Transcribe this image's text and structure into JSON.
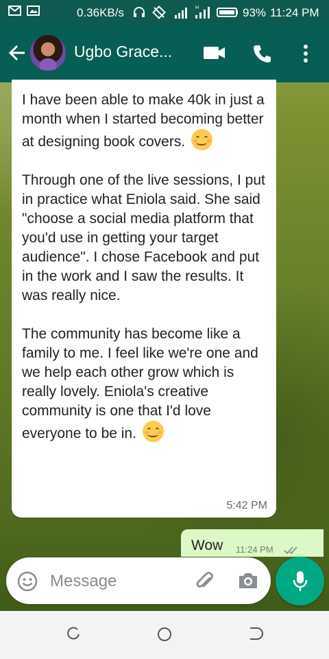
{
  "status_bar": {
    "speed": "0.36KB/s",
    "battery": "93%",
    "time": "11:24 PM"
  },
  "header": {
    "contact_name": "Ugbo Grace..."
  },
  "messages": [
    {
      "direction": "incoming",
      "paragraphs": [
        "I have been able to make 40k in just a month when I started becoming better at designing book covers.",
        "Through one of the live sessions, I put in practice what Eniola said. She said \"choose a social media platform that you'd use in getting your target audience\". I chose Facebook and put in the work and I saw the results. It was really nice.",
        "The community has become like a family to me. I feel like we're one and we help each other grow which is really lovely. Eniola's creative community is one that I'd love everyone to be in."
      ],
      "time": "5:42 PM"
    },
    {
      "direction": "outgoing",
      "text": "Wow",
      "time": "11:24 PM"
    }
  ],
  "composer": {
    "placeholder": "Message"
  },
  "icons": {
    "header": [
      "back-arrow-icon",
      "video-call-icon",
      "phone-icon",
      "more-options-icon"
    ],
    "composer": [
      "emoji-icon",
      "attach-icon",
      "camera-icon",
      "microphone-icon"
    ],
    "navigation": [
      "recent-apps-icon",
      "home-icon",
      "back-icon"
    ]
  },
  "colors": {
    "header": "#075e54",
    "status_bar": "#0f5a50",
    "outgoing_bubble": "#dcf8c6",
    "mic_button": "#01a884"
  }
}
